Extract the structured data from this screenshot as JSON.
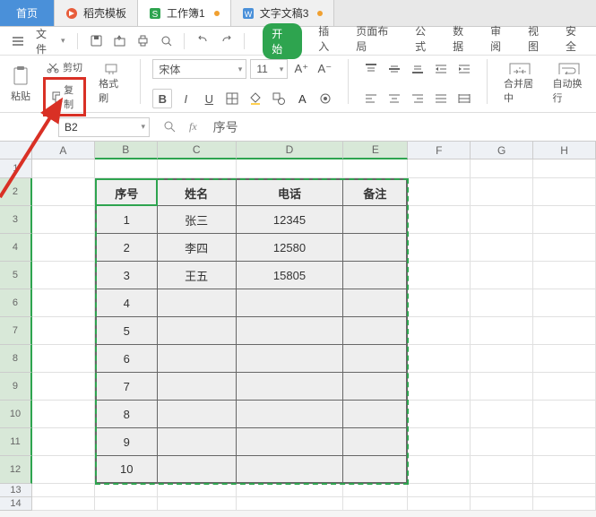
{
  "tabs": {
    "home": "首页",
    "t1": "稻壳模板",
    "t2": "工作簿1",
    "t3": "文字文稿3"
  },
  "ribbon": {
    "file": "文件",
    "tabs": [
      "开始",
      "插入",
      "页面布局",
      "公式",
      "数据",
      "审阅",
      "视图",
      "安全"
    ]
  },
  "clipboard": {
    "paste": "粘贴",
    "cut": "剪切",
    "copy": "复制",
    "format": "格式刷"
  },
  "font": {
    "name": "宋体",
    "size": "11",
    "merge": "合并居中",
    "wrap": "自动换行"
  },
  "namebox": "B2",
  "fx": "fx",
  "formula_value": "序号",
  "cols": [
    "A",
    "B",
    "C",
    "D",
    "E",
    "F",
    "G",
    "H"
  ],
  "rows": [
    "1",
    "2",
    "3",
    "4",
    "5",
    "6",
    "7",
    "8",
    "9",
    "10",
    "11",
    "12",
    "13",
    "14"
  ],
  "table": {
    "headers": [
      "序号",
      "姓名",
      "电话",
      "备注"
    ],
    "data": [
      [
        "1",
        "张三",
        "12345",
        ""
      ],
      [
        "2",
        "李四",
        "12580",
        ""
      ],
      [
        "3",
        "王五",
        "15805",
        ""
      ],
      [
        "4",
        "",
        "",
        ""
      ],
      [
        "5",
        "",
        "",
        ""
      ],
      [
        "6",
        "",
        "",
        ""
      ],
      [
        "7",
        "",
        "",
        ""
      ],
      [
        "8",
        "",
        "",
        ""
      ],
      [
        "9",
        "",
        "",
        ""
      ],
      [
        "10",
        "",
        "",
        ""
      ]
    ]
  }
}
